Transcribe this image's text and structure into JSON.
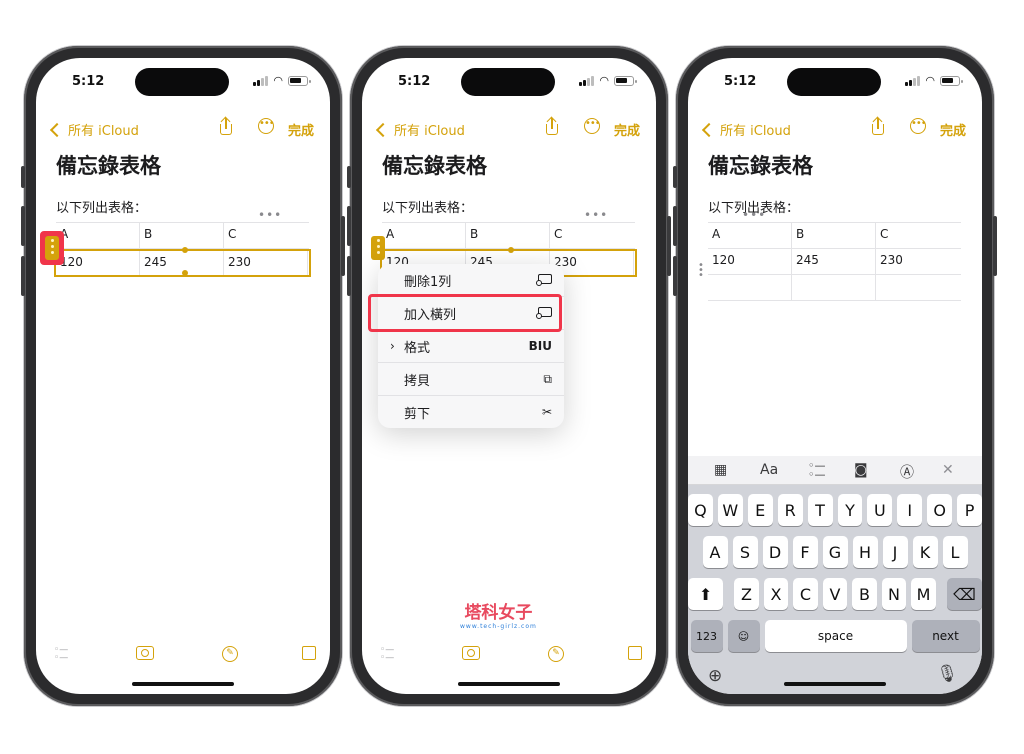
{
  "status": {
    "time": "5:12"
  },
  "nav": {
    "back_label": "所有 iCloud",
    "done_label": "完成"
  },
  "note": {
    "title": "備忘錄表格",
    "body": "以下列出表格："
  },
  "table": {
    "headers": [
      "A",
      "B",
      "C"
    ],
    "row": [
      "120",
      "245",
      "230"
    ]
  },
  "context_menu": {
    "items": [
      {
        "label": "刪除1列",
        "icon": "table-row-icon"
      },
      {
        "label": "加入橫列",
        "icon": "table-row-icon"
      },
      {
        "label": "格式",
        "icon": "BIU"
      },
      {
        "label": "拷貝",
        "icon": "copy-icon"
      },
      {
        "label": "剪下",
        "icon": "scissors-icon"
      }
    ]
  },
  "watermark": {
    "main": "塔科女子",
    "sub": "www.tech-girlz.com"
  },
  "keyboard": {
    "row1": [
      "Q",
      "W",
      "E",
      "R",
      "T",
      "Y",
      "U",
      "I",
      "O",
      "P"
    ],
    "row2": [
      "A",
      "S",
      "D",
      "F",
      "G",
      "H",
      "J",
      "K",
      "L"
    ],
    "row3": [
      "Z",
      "X",
      "C",
      "V",
      "B",
      "N",
      "M"
    ],
    "numbers_key": "123",
    "space_key": "space",
    "next_key": "next",
    "toolbar_format_label": "Aa"
  },
  "colors": {
    "accent": "#d4a20b",
    "highlight": "#f0354a"
  }
}
